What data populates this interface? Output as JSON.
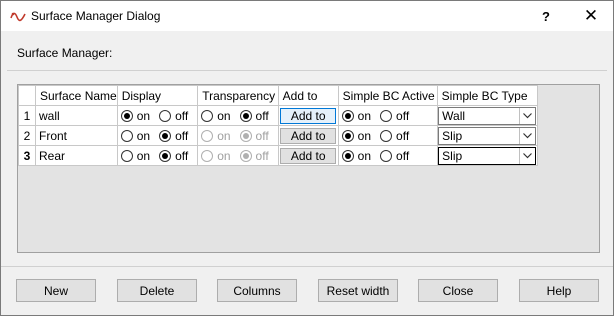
{
  "window": {
    "title": "Surface Manager Dialog",
    "help_glyph": "?",
    "close_glyph": "✕"
  },
  "group": {
    "label": "Surface Manager:"
  },
  "grid": {
    "columns": {
      "surface_name": "Surface Name",
      "display": "Display",
      "transparency": "Transparency",
      "add_to": "Add to",
      "simple_bc_active": "Simple BC Active",
      "simple_bc_type": "Simple BC Type"
    },
    "radio_labels": {
      "on": "on",
      "off": "off"
    },
    "rows": [
      {
        "num": "1",
        "name": "wall",
        "display": "on",
        "transparency": "off",
        "transparency_enabled": true,
        "add_to": "Add to",
        "bc_active": "on",
        "bc_type": "Wall"
      },
      {
        "num": "2",
        "name": "Front",
        "display": "off",
        "transparency": "off",
        "transparency_enabled": false,
        "add_to": "Add to",
        "bc_active": "on",
        "bc_type": "Slip"
      },
      {
        "num": "3",
        "name": "Rear",
        "display": "off",
        "transparency": "off",
        "transparency_enabled": false,
        "add_to": "Add to",
        "bc_active": "on",
        "bc_type": "Slip"
      }
    ]
  },
  "buttons": {
    "new": "New",
    "delete": "Delete",
    "columns": "Columns",
    "reset_width": "Reset width",
    "close": "Close",
    "help": "Help"
  },
  "colors": {
    "focus_blue": "#0078d7",
    "window_bg": "#f0f0f0",
    "icon_red": "#c0392b"
  }
}
